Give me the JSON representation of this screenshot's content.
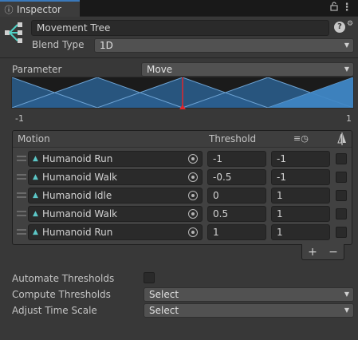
{
  "tab": {
    "title": "Inspector",
    "icon": "info-icon"
  },
  "header": {
    "name_value": "Movement Tree",
    "blend_type_label": "Blend Type",
    "blend_type_value": "1D"
  },
  "parameter": {
    "label": "Parameter",
    "value": "Move"
  },
  "graph": {
    "min_label": "-1",
    "max_label": "1",
    "marker_value": 0
  },
  "motion_list": {
    "columns": {
      "motion": "Motion",
      "threshold": "Threshold"
    },
    "rows": [
      {
        "motion": "Humanoid Run",
        "threshold": "-1",
        "time_scale": "-1"
      },
      {
        "motion": "Humanoid Walk",
        "threshold": "-0.5",
        "time_scale": "-1"
      },
      {
        "motion": "Humanoid Idle",
        "threshold": "0",
        "time_scale": "1"
      },
      {
        "motion": "Humanoid Walk",
        "threshold": "0.5",
        "time_scale": "1"
      },
      {
        "motion": "Humanoid Run",
        "threshold": "1",
        "time_scale": "1"
      }
    ],
    "add_symbol": "+",
    "remove_symbol": "−"
  },
  "settings": {
    "automate_label": "Automate Thresholds",
    "compute_label": "Compute Thresholds",
    "compute_value": "Select",
    "adjust_label": "Adjust Time Scale",
    "adjust_value": "Select"
  },
  "colors": {
    "accent": "#3a79bb",
    "graph_fill": "#2a5f8f",
    "marker": "#e0262b"
  }
}
